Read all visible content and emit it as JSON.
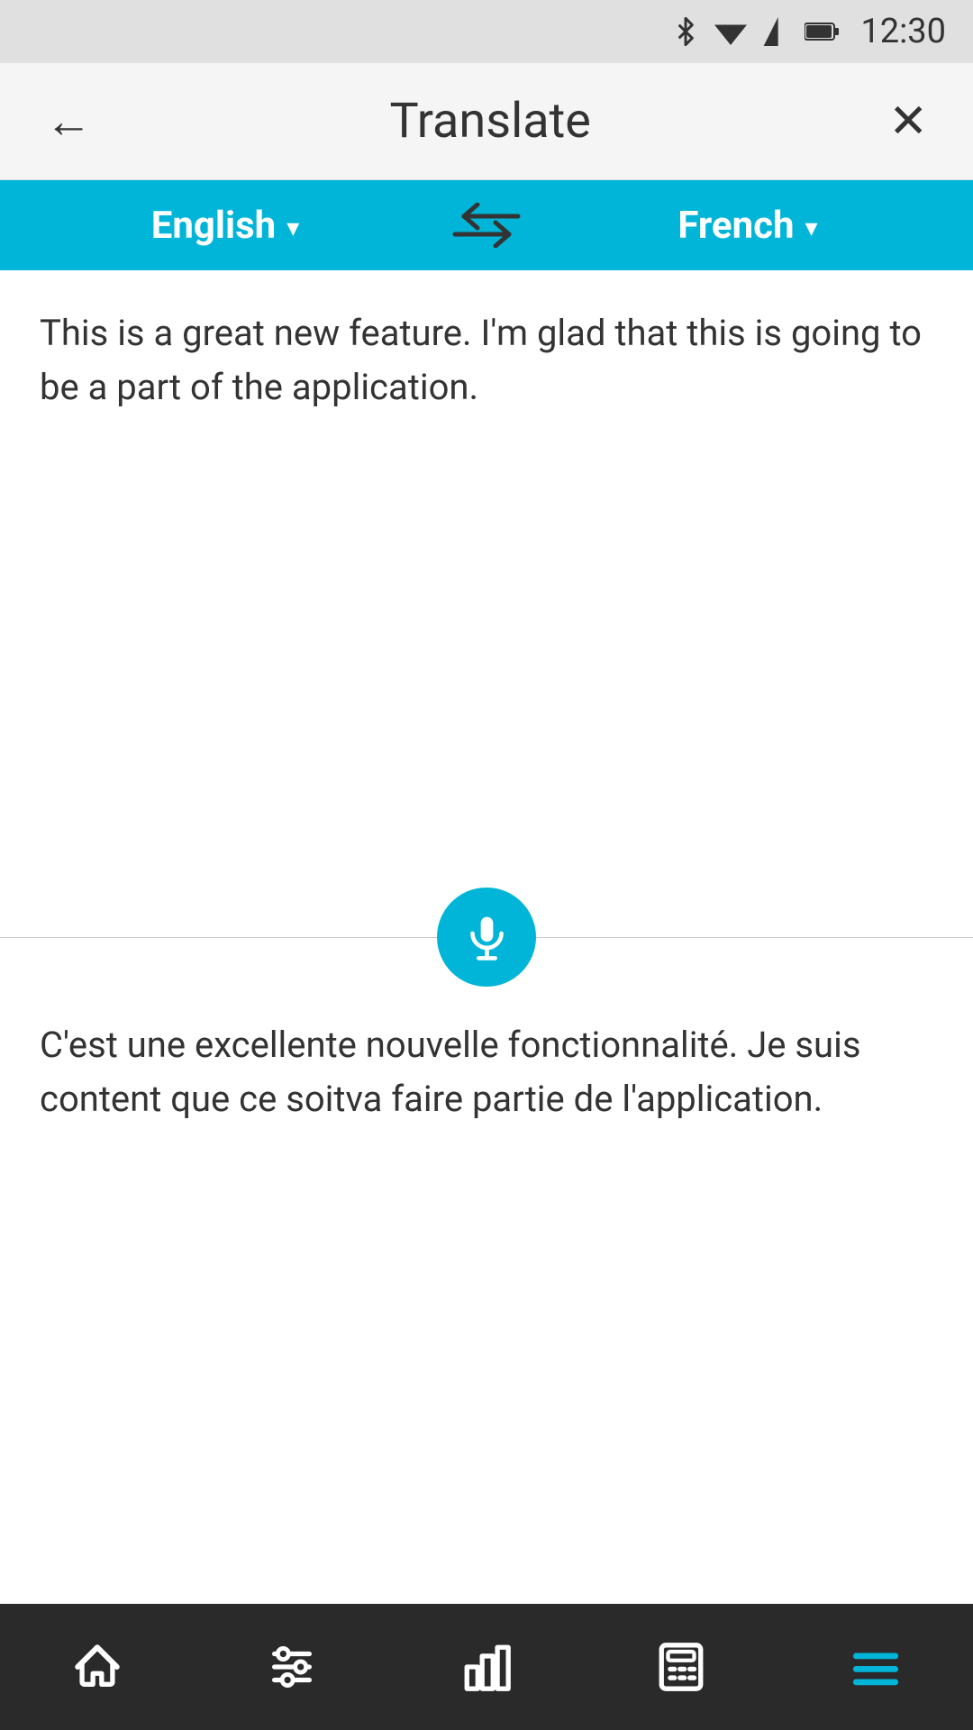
{
  "statusBar": {
    "time": "12:30"
  },
  "navBar": {
    "title": "Translate",
    "backLabel": "←",
    "closeLabel": "✕"
  },
  "langBar": {
    "sourceLang": "English",
    "targetLang": "French"
  },
  "source": {
    "text": "This is a great new feature. I'm glad that this is going to be a part of the application."
  },
  "target": {
    "text": "C'est une excellente nouvelle fonctionnalité. Je suis content que ce soitva faire partie de l'application."
  },
  "bottomNav": {
    "items": [
      "home",
      "settings",
      "chart",
      "calculator",
      "menu"
    ]
  },
  "colors": {
    "accent": "#00b5d8"
  }
}
